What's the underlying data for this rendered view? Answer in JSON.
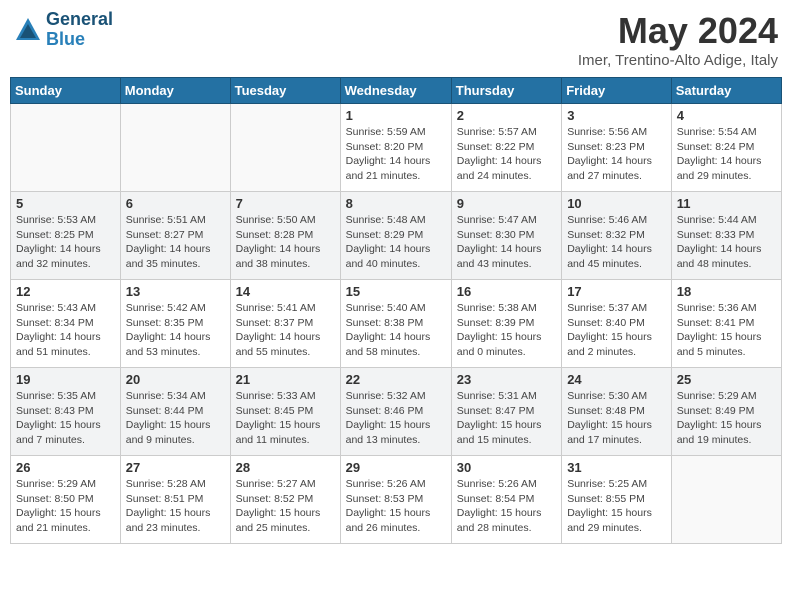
{
  "header": {
    "logo_line1": "General",
    "logo_line2": "Blue",
    "month": "May 2024",
    "location": "Imer, Trentino-Alto Adige, Italy"
  },
  "weekdays": [
    "Sunday",
    "Monday",
    "Tuesday",
    "Wednesday",
    "Thursday",
    "Friday",
    "Saturday"
  ],
  "weeks": [
    [
      {
        "day": "",
        "info": ""
      },
      {
        "day": "",
        "info": ""
      },
      {
        "day": "",
        "info": ""
      },
      {
        "day": "1",
        "info": "Sunrise: 5:59 AM\nSunset: 8:20 PM\nDaylight: 14 hours\nand 21 minutes."
      },
      {
        "day": "2",
        "info": "Sunrise: 5:57 AM\nSunset: 8:22 PM\nDaylight: 14 hours\nand 24 minutes."
      },
      {
        "day": "3",
        "info": "Sunrise: 5:56 AM\nSunset: 8:23 PM\nDaylight: 14 hours\nand 27 minutes."
      },
      {
        "day": "4",
        "info": "Sunrise: 5:54 AM\nSunset: 8:24 PM\nDaylight: 14 hours\nand 29 minutes."
      }
    ],
    [
      {
        "day": "5",
        "info": "Sunrise: 5:53 AM\nSunset: 8:25 PM\nDaylight: 14 hours\nand 32 minutes."
      },
      {
        "day": "6",
        "info": "Sunrise: 5:51 AM\nSunset: 8:27 PM\nDaylight: 14 hours\nand 35 minutes."
      },
      {
        "day": "7",
        "info": "Sunrise: 5:50 AM\nSunset: 8:28 PM\nDaylight: 14 hours\nand 38 minutes."
      },
      {
        "day": "8",
        "info": "Sunrise: 5:48 AM\nSunset: 8:29 PM\nDaylight: 14 hours\nand 40 minutes."
      },
      {
        "day": "9",
        "info": "Sunrise: 5:47 AM\nSunset: 8:30 PM\nDaylight: 14 hours\nand 43 minutes."
      },
      {
        "day": "10",
        "info": "Sunrise: 5:46 AM\nSunset: 8:32 PM\nDaylight: 14 hours\nand 45 minutes."
      },
      {
        "day": "11",
        "info": "Sunrise: 5:44 AM\nSunset: 8:33 PM\nDaylight: 14 hours\nand 48 minutes."
      }
    ],
    [
      {
        "day": "12",
        "info": "Sunrise: 5:43 AM\nSunset: 8:34 PM\nDaylight: 14 hours\nand 51 minutes."
      },
      {
        "day": "13",
        "info": "Sunrise: 5:42 AM\nSunset: 8:35 PM\nDaylight: 14 hours\nand 53 minutes."
      },
      {
        "day": "14",
        "info": "Sunrise: 5:41 AM\nSunset: 8:37 PM\nDaylight: 14 hours\nand 55 minutes."
      },
      {
        "day": "15",
        "info": "Sunrise: 5:40 AM\nSunset: 8:38 PM\nDaylight: 14 hours\nand 58 minutes."
      },
      {
        "day": "16",
        "info": "Sunrise: 5:38 AM\nSunset: 8:39 PM\nDaylight: 15 hours\nand 0 minutes."
      },
      {
        "day": "17",
        "info": "Sunrise: 5:37 AM\nSunset: 8:40 PM\nDaylight: 15 hours\nand 2 minutes."
      },
      {
        "day": "18",
        "info": "Sunrise: 5:36 AM\nSunset: 8:41 PM\nDaylight: 15 hours\nand 5 minutes."
      }
    ],
    [
      {
        "day": "19",
        "info": "Sunrise: 5:35 AM\nSunset: 8:43 PM\nDaylight: 15 hours\nand 7 minutes."
      },
      {
        "day": "20",
        "info": "Sunrise: 5:34 AM\nSunset: 8:44 PM\nDaylight: 15 hours\nand 9 minutes."
      },
      {
        "day": "21",
        "info": "Sunrise: 5:33 AM\nSunset: 8:45 PM\nDaylight: 15 hours\nand 11 minutes."
      },
      {
        "day": "22",
        "info": "Sunrise: 5:32 AM\nSunset: 8:46 PM\nDaylight: 15 hours\nand 13 minutes."
      },
      {
        "day": "23",
        "info": "Sunrise: 5:31 AM\nSunset: 8:47 PM\nDaylight: 15 hours\nand 15 minutes."
      },
      {
        "day": "24",
        "info": "Sunrise: 5:30 AM\nSunset: 8:48 PM\nDaylight: 15 hours\nand 17 minutes."
      },
      {
        "day": "25",
        "info": "Sunrise: 5:29 AM\nSunset: 8:49 PM\nDaylight: 15 hours\nand 19 minutes."
      }
    ],
    [
      {
        "day": "26",
        "info": "Sunrise: 5:29 AM\nSunset: 8:50 PM\nDaylight: 15 hours\nand 21 minutes."
      },
      {
        "day": "27",
        "info": "Sunrise: 5:28 AM\nSunset: 8:51 PM\nDaylight: 15 hours\nand 23 minutes."
      },
      {
        "day": "28",
        "info": "Sunrise: 5:27 AM\nSunset: 8:52 PM\nDaylight: 15 hours\nand 25 minutes."
      },
      {
        "day": "29",
        "info": "Sunrise: 5:26 AM\nSunset: 8:53 PM\nDaylight: 15 hours\nand 26 minutes."
      },
      {
        "day": "30",
        "info": "Sunrise: 5:26 AM\nSunset: 8:54 PM\nDaylight: 15 hours\nand 28 minutes."
      },
      {
        "day": "31",
        "info": "Sunrise: 5:25 AM\nSunset: 8:55 PM\nDaylight: 15 hours\nand 29 minutes."
      },
      {
        "day": "",
        "info": ""
      }
    ]
  ]
}
